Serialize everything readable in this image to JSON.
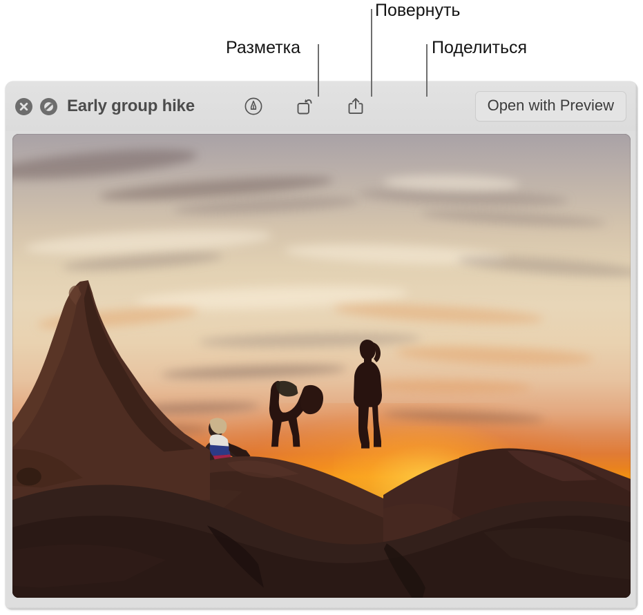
{
  "callouts": [
    {
      "label": "Разметка",
      "target": "markup-tool"
    },
    {
      "label": "Повернуть",
      "target": "rotate-tool"
    },
    {
      "label": "Поделиться",
      "target": "share-tool"
    }
  ],
  "window": {
    "title": "Early group hike",
    "close_button": "close-icon",
    "markup_toggle": "quicklook-markup-icon",
    "toolbar": {
      "markup_label": "Разметка",
      "rotate_label": "Повернуть",
      "share_label": "Поделиться"
    },
    "open_button": "Open with Preview"
  },
  "photo": {
    "description": "Three hikers silhouetted on red sandstone rocks at sunset",
    "alt_title": "Early group hike"
  },
  "colors": {
    "titlebar_bg": "#dedede",
    "window_bg": "#dedede",
    "title_text": "#4c4c4c",
    "button_text": "#3b3b3b",
    "button_bg": "#e4e4e4",
    "icon_stroke": "#545454",
    "callout_text": "#141414",
    "callout_line": "#6e6e6e",
    "sky_top": "#a9a2a6",
    "sky_mid": "#e8d6b8",
    "sunset_orange": "#f09112",
    "rock_dark": "#3a2018"
  }
}
